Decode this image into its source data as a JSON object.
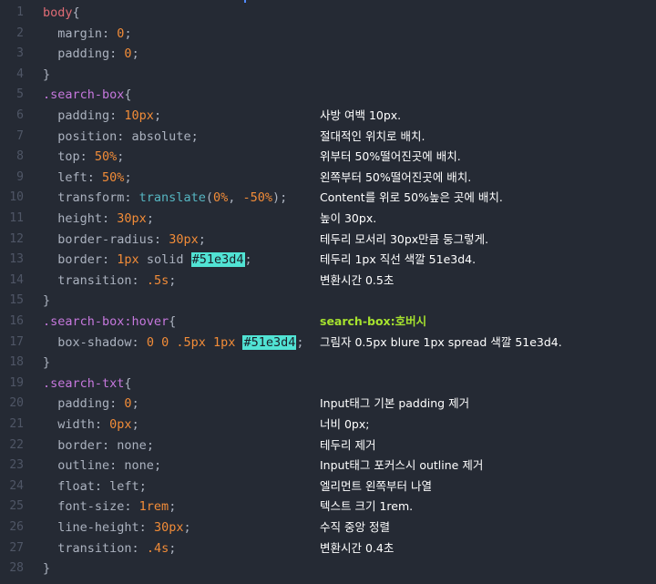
{
  "editor": {
    "highlight_color": "#51e3d4",
    "lines": [
      {
        "n": "1",
        "tokens": [
          {
            "t": "body",
            "c": "sel"
          },
          {
            "t": "{",
            "c": "punc"
          }
        ],
        "comment": ""
      },
      {
        "n": "2",
        "tokens": [
          {
            "t": "  margin",
            "c": "prop"
          },
          {
            "t": ": ",
            "c": "punc"
          },
          {
            "t": "0",
            "c": "num"
          },
          {
            "t": ";",
            "c": "punc"
          }
        ],
        "comment": ""
      },
      {
        "n": "3",
        "tokens": [
          {
            "t": "  padding",
            "c": "prop"
          },
          {
            "t": ": ",
            "c": "punc"
          },
          {
            "t": "0",
            "c": "num"
          },
          {
            "t": ";",
            "c": "punc"
          }
        ],
        "comment": ""
      },
      {
        "n": "4",
        "tokens": [
          {
            "t": "}",
            "c": "punc"
          }
        ],
        "comment": ""
      },
      {
        "n": "5",
        "tokens": [
          {
            "t": ".search-box",
            "c": "cls"
          },
          {
            "t": "{",
            "c": "punc"
          }
        ],
        "comment": ""
      },
      {
        "n": "6",
        "tokens": [
          {
            "t": "  padding",
            "c": "prop"
          },
          {
            "t": ": ",
            "c": "punc"
          },
          {
            "t": "10px",
            "c": "num"
          },
          {
            "t": ";",
            "c": "punc"
          }
        ],
        "comment": "사방 여백 10px."
      },
      {
        "n": "7",
        "tokens": [
          {
            "t": "  position",
            "c": "prop"
          },
          {
            "t": ": ",
            "c": "punc"
          },
          {
            "t": "absolute",
            "c": "kw"
          },
          {
            "t": ";",
            "c": "punc"
          }
        ],
        "comment": "절대적인 위치로 배치."
      },
      {
        "n": "8",
        "tokens": [
          {
            "t": "  top",
            "c": "prop"
          },
          {
            "t": ": ",
            "c": "punc"
          },
          {
            "t": "50%",
            "c": "num"
          },
          {
            "t": ";",
            "c": "punc"
          }
        ],
        "comment": "위부터 50%떨어진곳에 배치."
      },
      {
        "n": "9",
        "tokens": [
          {
            "t": "  left",
            "c": "prop"
          },
          {
            "t": ": ",
            "c": "punc"
          },
          {
            "t": "50%",
            "c": "num"
          },
          {
            "t": ";",
            "c": "punc"
          }
        ],
        "comment": "왼쪽부터 50%떨어진곳에 배치."
      },
      {
        "n": "10",
        "tokens": [
          {
            "t": "  transform",
            "c": "prop"
          },
          {
            "t": ": ",
            "c": "punc"
          },
          {
            "t": "translate",
            "c": "fn"
          },
          {
            "t": "(",
            "c": "punc"
          },
          {
            "t": "0%",
            "c": "num"
          },
          {
            "t": ", ",
            "c": "punc"
          },
          {
            "t": "-50%",
            "c": "num"
          },
          {
            "t": ");",
            "c": "punc"
          }
        ],
        "comment": "Content를 위로 50%높은 곳에 배치."
      },
      {
        "n": "11",
        "tokens": [
          {
            "t": "  height",
            "c": "prop"
          },
          {
            "t": ": ",
            "c": "punc"
          },
          {
            "t": "30px",
            "c": "num"
          },
          {
            "t": ";",
            "c": "punc"
          }
        ],
        "comment": "높이 30px."
      },
      {
        "n": "12",
        "tokens": [
          {
            "t": "  border-radius",
            "c": "prop"
          },
          {
            "t": ": ",
            "c": "punc"
          },
          {
            "t": "30px",
            "c": "num"
          },
          {
            "t": ";",
            "c": "punc"
          }
        ],
        "comment": "테두리 모서리 30px만큼 둥그렇게."
      },
      {
        "n": "13",
        "tokens": [
          {
            "t": "  border",
            "c": "prop"
          },
          {
            "t": ": ",
            "c": "punc"
          },
          {
            "t": "1px",
            "c": "num"
          },
          {
            "t": " solid ",
            "c": "kw"
          },
          {
            "t": "#51e3d4",
            "c": "hl"
          },
          {
            "t": ";",
            "c": "punc"
          }
        ],
        "comment": "테두리 1px 직선 색깔 51e3d4."
      },
      {
        "n": "14",
        "tokens": [
          {
            "t": "  transition",
            "c": "prop"
          },
          {
            "t": ": ",
            "c": "punc"
          },
          {
            "t": ".5s",
            "c": "num"
          },
          {
            "t": ";",
            "c": "punc"
          }
        ],
        "comment": "변환시간 0.5초"
      },
      {
        "n": "15",
        "tokens": [
          {
            "t": "}",
            "c": "punc"
          }
        ],
        "comment": ""
      },
      {
        "n": "16",
        "tokens": [
          {
            "t": ".search-box:hover",
            "c": "cls"
          },
          {
            "t": "{",
            "c": "punc"
          }
        ],
        "comment": "search-box:호버시",
        "heading": true
      },
      {
        "n": "17",
        "tokens": [
          {
            "t": "  box-shadow",
            "c": "prop"
          },
          {
            "t": ": ",
            "c": "punc"
          },
          {
            "t": "0 0 .5px 1px ",
            "c": "num"
          },
          {
            "t": "#51e3d4",
            "c": "hl"
          },
          {
            "t": ";",
            "c": "punc"
          }
        ],
        "comment": "그림자 0.5px blure 1px spread 색깔 51e3d4."
      },
      {
        "n": "18",
        "tokens": [
          {
            "t": "}",
            "c": "punc"
          }
        ],
        "comment": ""
      },
      {
        "n": "19",
        "tokens": [
          {
            "t": ".search-txt",
            "c": "cls"
          },
          {
            "t": "{",
            "c": "punc"
          }
        ],
        "comment": ""
      },
      {
        "n": "20",
        "tokens": [
          {
            "t": "  padding",
            "c": "prop"
          },
          {
            "t": ": ",
            "c": "punc"
          },
          {
            "t": "0",
            "c": "num"
          },
          {
            "t": ";",
            "c": "punc"
          }
        ],
        "comment": "Input태그 기본 padding 제거"
      },
      {
        "n": "21",
        "tokens": [
          {
            "t": "  width",
            "c": "prop"
          },
          {
            "t": ": ",
            "c": "punc"
          },
          {
            "t": "0px",
            "c": "num"
          },
          {
            "t": ";",
            "c": "punc"
          }
        ],
        "comment": "너비 0px;"
      },
      {
        "n": "22",
        "tokens": [
          {
            "t": "  border",
            "c": "prop"
          },
          {
            "t": ": ",
            "c": "punc"
          },
          {
            "t": "none",
            "c": "kw"
          },
          {
            "t": ";",
            "c": "punc"
          }
        ],
        "comment": "테두리 제거"
      },
      {
        "n": "23",
        "tokens": [
          {
            "t": "  outline",
            "c": "prop"
          },
          {
            "t": ": ",
            "c": "punc"
          },
          {
            "t": "none",
            "c": "kw"
          },
          {
            "t": ";",
            "c": "punc"
          }
        ],
        "comment": "Input태그 포커스시 outline 제거"
      },
      {
        "n": "24",
        "tokens": [
          {
            "t": "  float",
            "c": "prop"
          },
          {
            "t": ": ",
            "c": "punc"
          },
          {
            "t": "left",
            "c": "kw"
          },
          {
            "t": ";",
            "c": "punc"
          }
        ],
        "comment": "엘리먼트 왼쪽부터 나열"
      },
      {
        "n": "25",
        "tokens": [
          {
            "t": "  font-size",
            "c": "prop"
          },
          {
            "t": ": ",
            "c": "punc"
          },
          {
            "t": "1rem",
            "c": "num"
          },
          {
            "t": ";",
            "c": "punc"
          }
        ],
        "comment": "텍스트 크기 1rem."
      },
      {
        "n": "26",
        "tokens": [
          {
            "t": "  line-height",
            "c": "prop"
          },
          {
            "t": ": ",
            "c": "punc"
          },
          {
            "t": "30px",
            "c": "num"
          },
          {
            "t": ";",
            "c": "punc"
          }
        ],
        "comment": "수직 중앙 정렬"
      },
      {
        "n": "27",
        "tokens": [
          {
            "t": "  transition",
            "c": "prop"
          },
          {
            "t": ": ",
            "c": "punc"
          },
          {
            "t": ".4s",
            "c": "num"
          },
          {
            "t": ";",
            "c": "punc"
          }
        ],
        "comment": "변환시간 0.4초"
      },
      {
        "n": "28",
        "tokens": [
          {
            "t": "}",
            "c": "punc"
          }
        ],
        "comment": ""
      }
    ]
  }
}
